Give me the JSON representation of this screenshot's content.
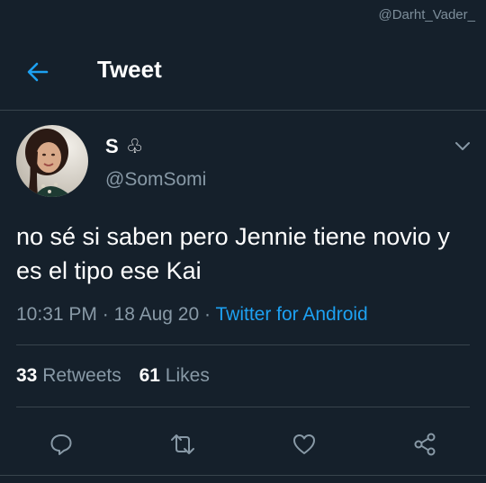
{
  "watermark": "@Darht_Vader_",
  "header": {
    "title": "Tweet",
    "back_icon": "arrow-left-icon"
  },
  "tweet": {
    "display_name": "S",
    "name_emoji": "♧",
    "handle": "@SomSomi",
    "text": "no sé si saben pero Jennie tiene novio y es el tipo ese Kai",
    "time": "10:31 PM",
    "date": "18 Aug 20",
    "separator": "·",
    "source": "Twitter for Android",
    "retweets_count": "33",
    "retweets_label": "Retweets",
    "likes_count": "61",
    "likes_label": "Likes"
  },
  "colors": {
    "background": "#15202b",
    "accent": "#1da1f2",
    "secondary_text": "#8899a6",
    "divider": "#38444d"
  },
  "actions": [
    "reply-icon",
    "retweet-icon",
    "like-icon",
    "share-icon"
  ]
}
